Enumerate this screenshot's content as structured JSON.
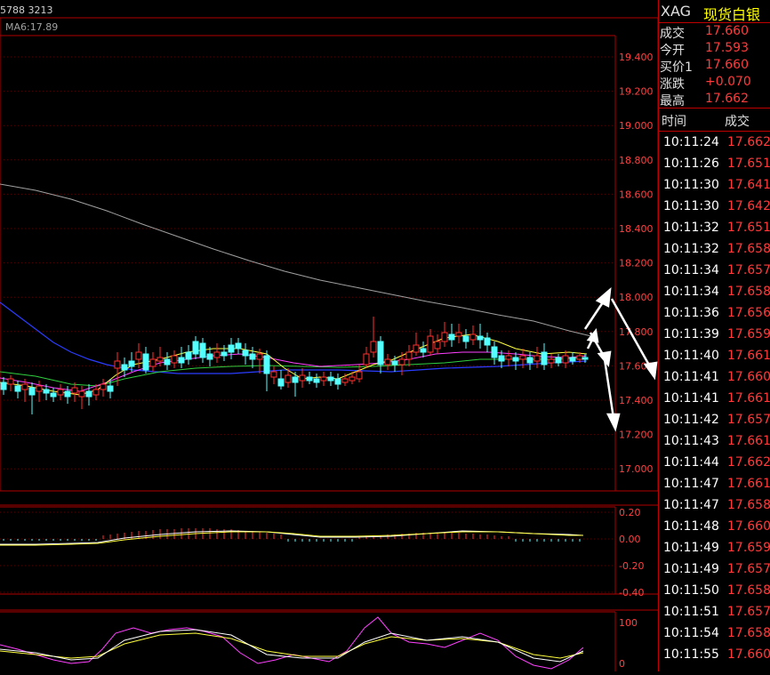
{
  "chart": {
    "header_text": "5788 3213",
    "ma_label": "MA6:17.89",
    "price_axis": [
      "19.400",
      "19.200",
      "19.000",
      "18.800",
      "18.600",
      "18.400",
      "18.200",
      "18.000",
      "17.800",
      "17.600",
      "17.400",
      "17.200",
      "17.000"
    ],
    "macd_axis": [
      "0.20",
      "0.00",
      "-0.20",
      "-0.40"
    ],
    "kdj_axis": [
      "100",
      "0"
    ],
    "colors": {
      "up": "#ff3030",
      "down": "#54ffff",
      "ma_gray": "#a0a0a0",
      "ma_blue": "#2a3cff",
      "grid": "#b00000"
    }
  },
  "quote": {
    "symbol": "XAG",
    "name": "现货白银",
    "rows": [
      {
        "label": "成交",
        "value": "17.660"
      },
      {
        "label": "今开",
        "value": "17.593"
      },
      {
        "label": "买价1",
        "value": "17.660"
      },
      {
        "label": "涨跌",
        "value": "+0.070"
      },
      {
        "label": "最高",
        "value": "17.662"
      }
    ],
    "col_time": "时间",
    "col_price": "成交",
    "ticks": [
      {
        "time": "10:11:24",
        "price": "17.662"
      },
      {
        "time": "10:11:26",
        "price": "17.651"
      },
      {
        "time": "10:11:30",
        "price": "17.641"
      },
      {
        "time": "10:11:30",
        "price": "17.642"
      },
      {
        "time": "10:11:32",
        "price": "17.651"
      },
      {
        "time": "10:11:32",
        "price": "17.658"
      },
      {
        "time": "10:11:34",
        "price": "17.657"
      },
      {
        "time": "10:11:34",
        "price": "17.658"
      },
      {
        "time": "10:11:36",
        "price": "17.656"
      },
      {
        "time": "10:11:39",
        "price": "17.659"
      },
      {
        "time": "10:11:40",
        "price": "17.661"
      },
      {
        "time": "10:11:41",
        "price": "17.660"
      },
      {
        "time": "10:11:41",
        "price": "17.661"
      },
      {
        "time": "10:11:42",
        "price": "17.657"
      },
      {
        "time": "10:11:43",
        "price": "17.661"
      },
      {
        "time": "10:11:44",
        "price": "17.662"
      },
      {
        "time": "10:11:47",
        "price": "17.661"
      },
      {
        "time": "10:11:47",
        "price": "17.658"
      },
      {
        "time": "10:11:48",
        "price": "17.660"
      },
      {
        "time": "10:11:49",
        "price": "17.659"
      },
      {
        "time": "10:11:49",
        "price": "17.657"
      },
      {
        "time": "10:11:50",
        "price": "17.658"
      },
      {
        "time": "10:11:51",
        "price": "17.657"
      },
      {
        "time": "10:11:54",
        "price": "17.658"
      },
      {
        "time": "10:11:55",
        "price": "17.660"
      }
    ]
  }
}
